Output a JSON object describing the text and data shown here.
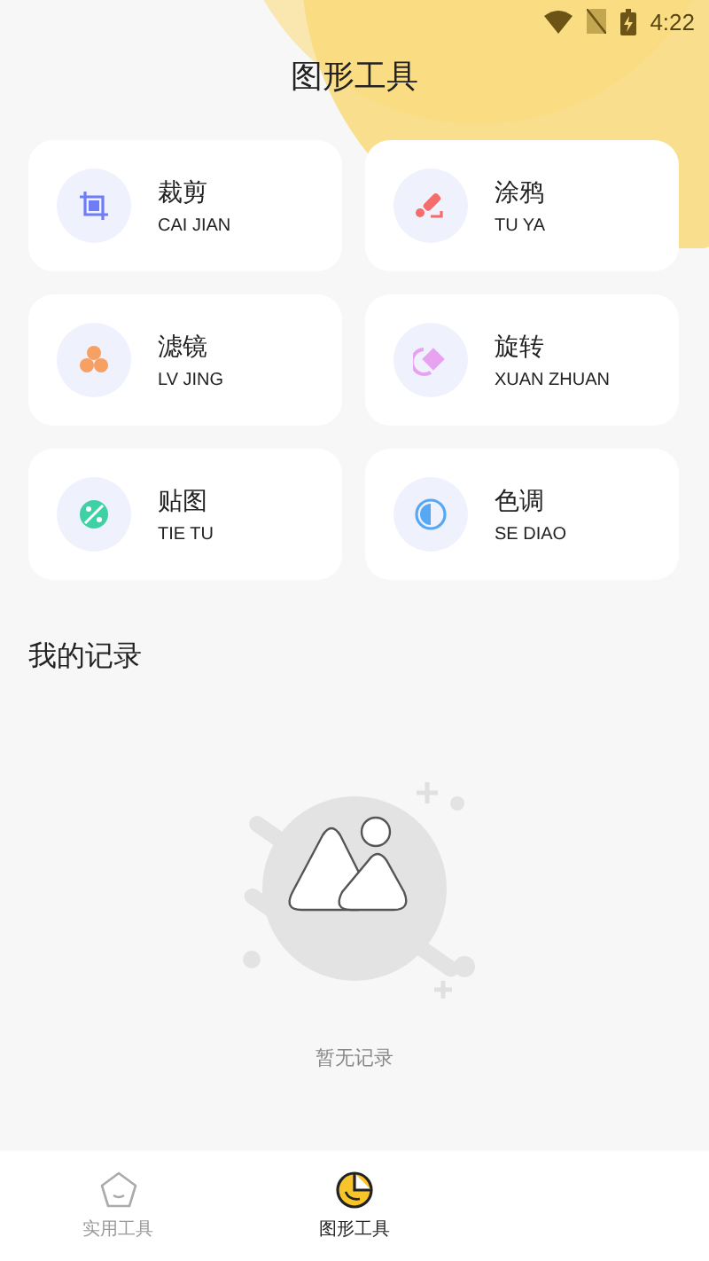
{
  "status_bar": {
    "time": "4:22"
  },
  "title": "图形工具",
  "tools": [
    {
      "name": "裁剪",
      "pinyin": "CAI JIAN"
    },
    {
      "name": "涂鸦",
      "pinyin": "TU YA"
    },
    {
      "name": "滤镜",
      "pinyin": "LV JING"
    },
    {
      "name": "旋转",
      "pinyin": "XUAN ZHUAN"
    },
    {
      "name": "贴图",
      "pinyin": "TIE TU"
    },
    {
      "name": "色调",
      "pinyin": "SE DIAO"
    }
  ],
  "records": {
    "title": "我的记录",
    "empty_text": "暂无记录"
  },
  "bottom_nav": [
    {
      "label": "实用工具",
      "selected": false
    },
    {
      "label": "图形工具",
      "selected": true
    }
  ]
}
